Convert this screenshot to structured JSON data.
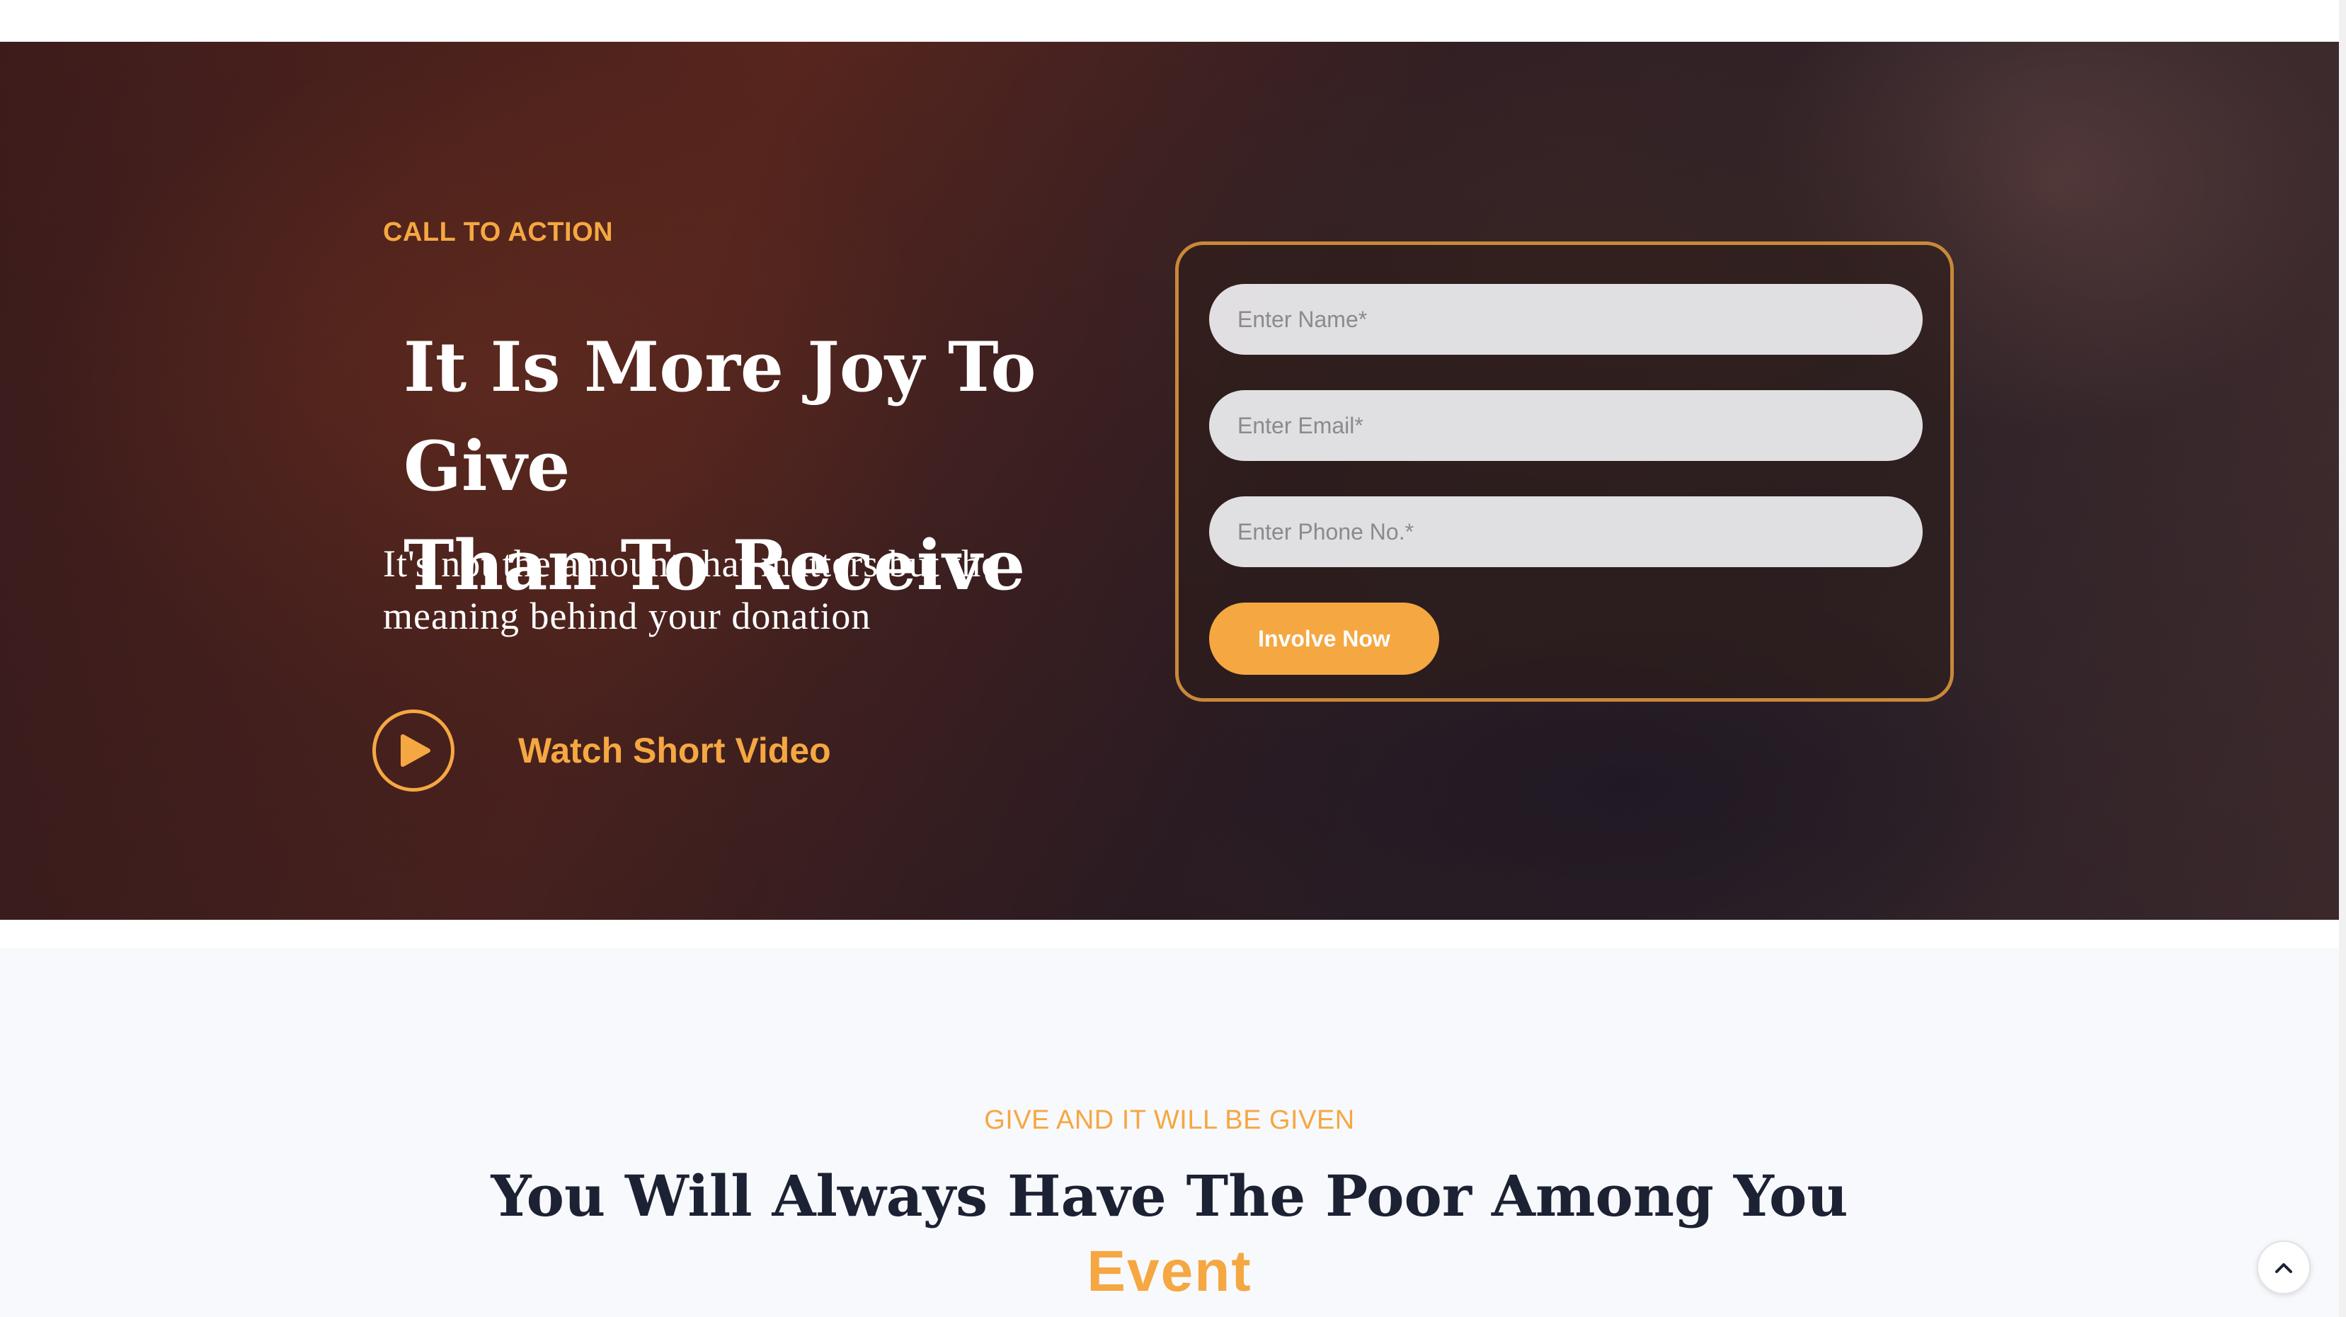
{
  "hero": {
    "eyebrow": "CALL TO ACTION",
    "title_lines": [
      "It Is More Joy To Give",
      "Than To Receive"
    ],
    "subtitle_lines": [
      "It's not the amount that matters but the",
      "meaning behind your donation"
    ],
    "video_label": "Watch Short Video"
  },
  "form": {
    "name_placeholder": "Enter Name*",
    "email_placeholder": "Enter Email*",
    "phone_placeholder": "Enter Phone No.*",
    "submit_label": "Involve Now"
  },
  "section": {
    "eyebrow": "GIVE AND IT WILL BE GIVEN",
    "title": "You Will Always Have The Poor Among You",
    "accent": "Event"
  },
  "icons": {
    "play": "play-icon",
    "scroll_top": "chevron-up-icon"
  },
  "colors": {
    "accent": "#f5a742",
    "dark_text": "#1c2233",
    "section_bg": "#f8f9fc"
  }
}
